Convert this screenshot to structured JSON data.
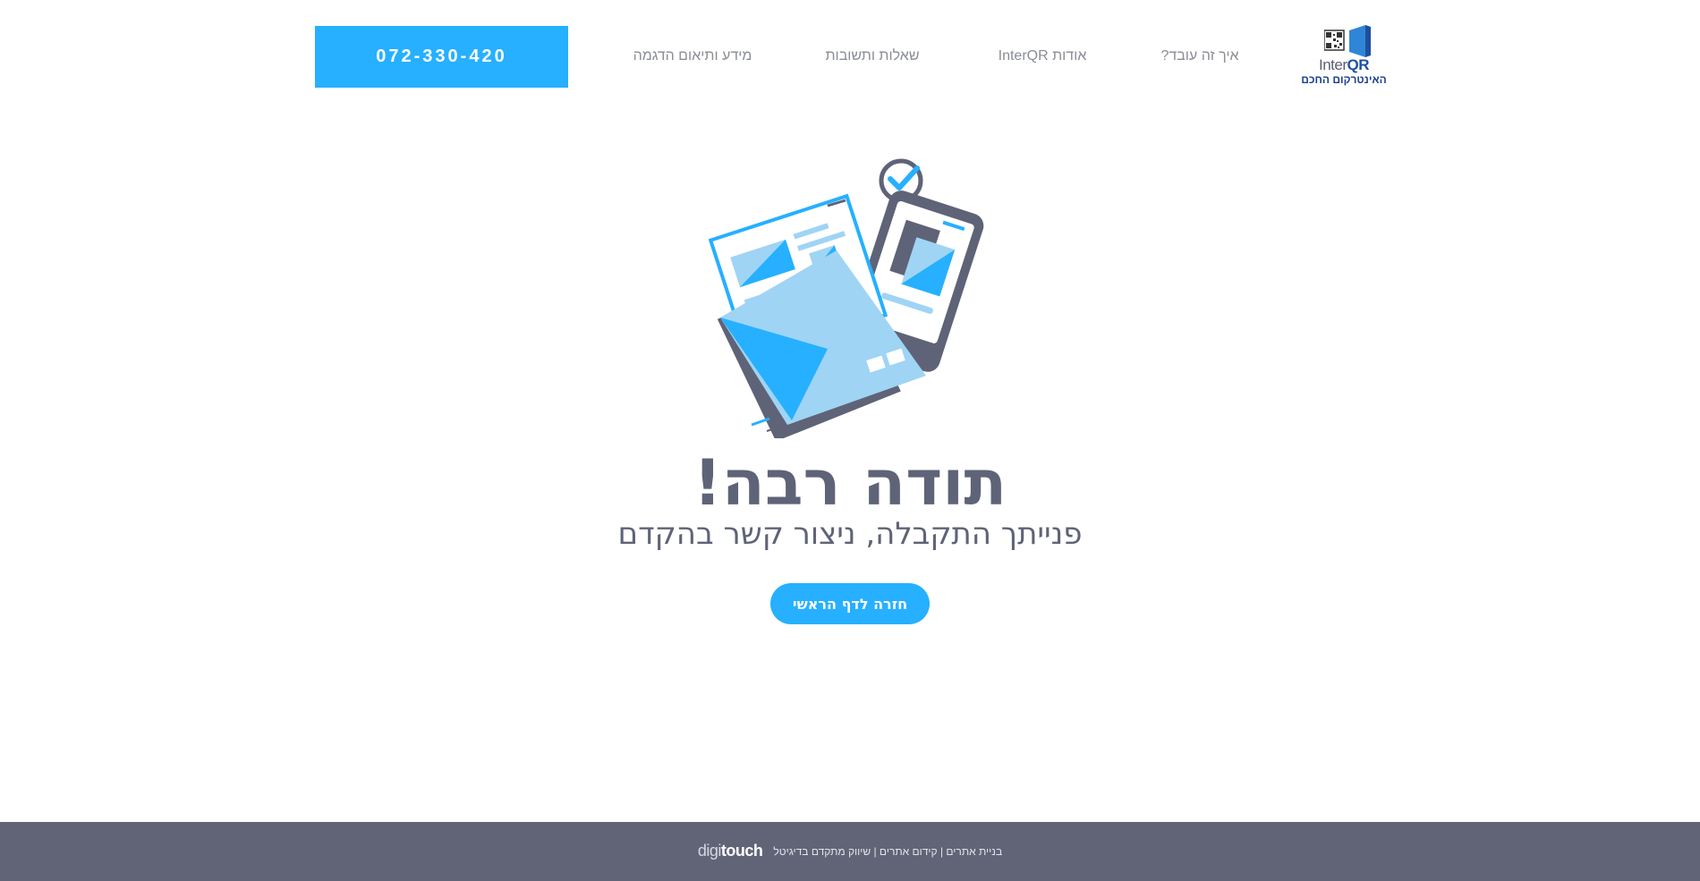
{
  "header": {
    "logo": {
      "wordmark_inter": "Inter",
      "wordmark_qr": "QR",
      "tagline": "האינטרקום החכם"
    },
    "nav": {
      "how_it_works": "איך זה עובד?",
      "about": "אודות InterQR",
      "faq": "שאלות ותשובות",
      "info_demo": "מידע ותיאום הדגמה"
    },
    "phone": "072-330-420"
  },
  "main": {
    "title": "תודה רבה!",
    "subtitle": "פנייתך התקבלה, ניצור קשר בהקדם",
    "home_button": "חזרה לדף הראשי",
    "illustration_icon": "envelope-phone-check-icon"
  },
  "footer": {
    "links_text": "בניית אתרים | קידום אתרים | שיווק מתקדם בדיגיטל",
    "brand_digi": "digi",
    "brand_touch": "touch"
  },
  "colors": {
    "accent": "#26b0ff",
    "text": "#5f6377",
    "footer_bg": "#616477",
    "logo_blue": "#1d3f8f"
  }
}
